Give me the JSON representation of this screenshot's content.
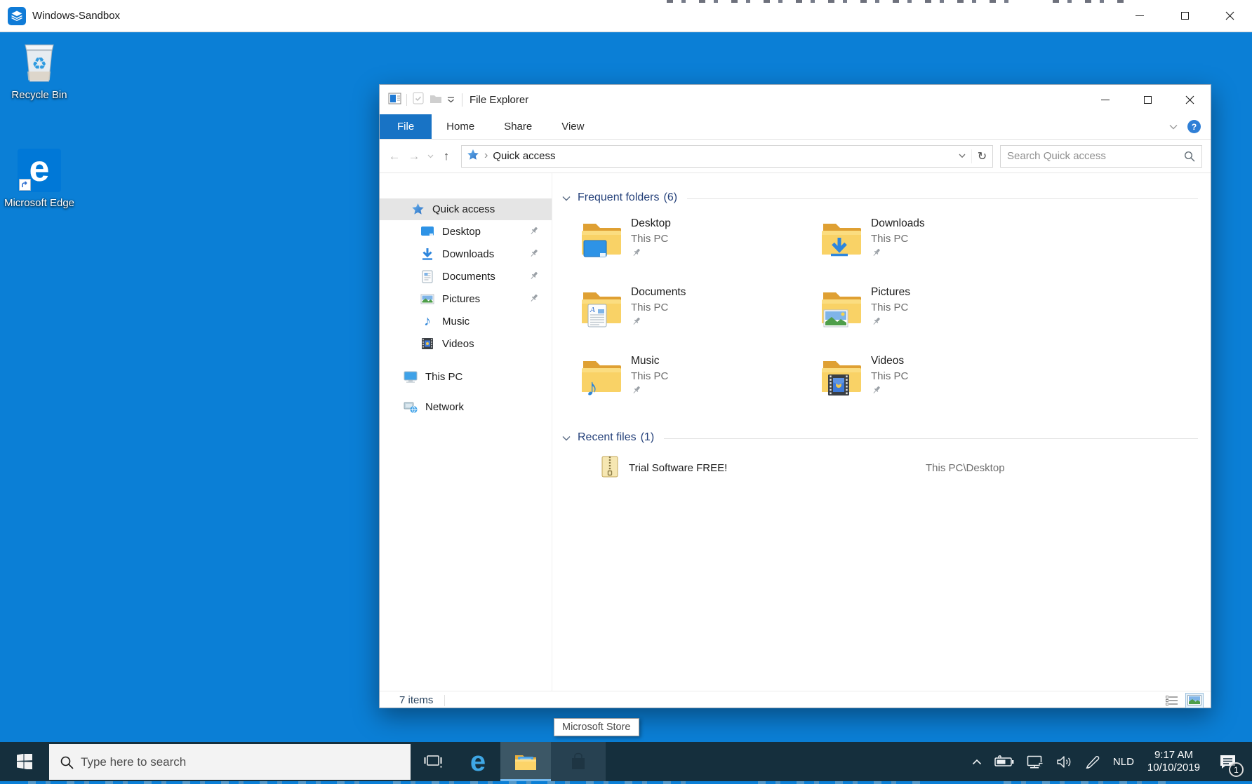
{
  "host": {
    "title": "Windows-Sandbox"
  },
  "glyphs": {
    "back": "←",
    "forward": "→",
    "up": "↑",
    "refresh": "↻",
    "help": "?",
    "breadcrumb_chevron": "›",
    "music_note": "♪",
    "recycle_symbol": "♻",
    "edge_letter": "e"
  },
  "desktop": {
    "icons": [
      {
        "label": "Recycle Bin"
      },
      {
        "label": "Microsoft Edge"
      }
    ]
  },
  "explorer": {
    "title": "File Explorer",
    "tabs": [
      {
        "label": "File"
      },
      {
        "label": "Home"
      },
      {
        "label": "Share"
      },
      {
        "label": "View"
      }
    ],
    "address": {
      "location": "Quick access",
      "search_placeholder": "Search Quick access"
    },
    "nav": {
      "quick_access": {
        "label": "Quick access"
      },
      "items": [
        {
          "label": "Desktop",
          "pinned": true
        },
        {
          "label": "Downloads",
          "pinned": true
        },
        {
          "label": "Documents",
          "pinned": true
        },
        {
          "label": "Pictures",
          "pinned": true
        },
        {
          "label": "Music",
          "pinned": false
        },
        {
          "label": "Videos",
          "pinned": false
        }
      ],
      "this_pc": {
        "label": "This PC"
      },
      "network": {
        "label": "Network"
      }
    },
    "sections": {
      "frequent": {
        "label": "Frequent folders",
        "count": "(6)"
      },
      "recent": {
        "label": "Recent files",
        "count": "(1)"
      }
    },
    "frequent_folders": [
      {
        "name": "Desktop",
        "location": "This PC"
      },
      {
        "name": "Downloads",
        "location": "This PC"
      },
      {
        "name": "Documents",
        "location": "This PC"
      },
      {
        "name": "Pictures",
        "location": "This PC"
      },
      {
        "name": "Music",
        "location": "This PC"
      },
      {
        "name": "Videos",
        "location": "This PC"
      }
    ],
    "recent_files": [
      {
        "name": "Trial Software FREE!",
        "location": "This PC\\Desktop"
      }
    ],
    "status": {
      "items": "7 items"
    }
  },
  "taskbar": {
    "search_placeholder": "Type here to search",
    "tooltip": "Microsoft Store",
    "tray": {
      "language": "NLD",
      "time": "9:17 AM",
      "date": "10/10/2019",
      "notification_badge": "1"
    }
  }
}
